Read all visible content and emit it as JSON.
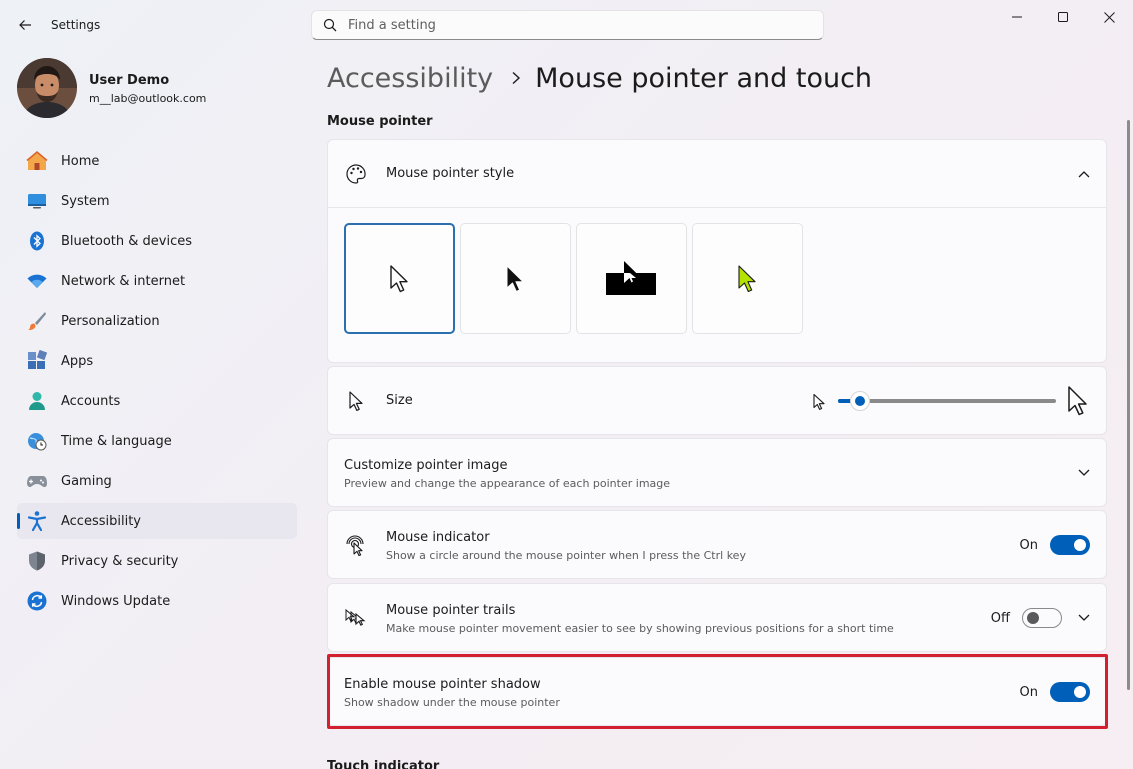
{
  "window": {
    "app_title": "Settings"
  },
  "search": {
    "placeholder": "Find a setting"
  },
  "user": {
    "name": "User Demo",
    "email": "m__lab@outlook.com"
  },
  "sidebar": {
    "items": [
      {
        "label": "Home",
        "icon": "home-icon"
      },
      {
        "label": "System",
        "icon": "system-icon"
      },
      {
        "label": "Bluetooth & devices",
        "icon": "bluetooth-icon"
      },
      {
        "label": "Network & internet",
        "icon": "wifi-icon"
      },
      {
        "label": "Personalization",
        "icon": "brush-icon"
      },
      {
        "label": "Apps",
        "icon": "apps-icon"
      },
      {
        "label": "Accounts",
        "icon": "person-icon"
      },
      {
        "label": "Time & language",
        "icon": "clock-globe-icon"
      },
      {
        "label": "Gaming",
        "icon": "gamepad-icon"
      },
      {
        "label": "Accessibility",
        "icon": "accessibility-icon",
        "active": true
      },
      {
        "label": "Privacy & security",
        "icon": "shield-icon"
      },
      {
        "label": "Windows Update",
        "icon": "update-icon"
      }
    ]
  },
  "breadcrumb": {
    "parent": "Accessibility",
    "current": "Mouse pointer and touch"
  },
  "sections": {
    "mouse_pointer": "Mouse pointer",
    "touch_indicator": "Touch indicator"
  },
  "settings": {
    "pointer_style": {
      "title": "Mouse pointer style",
      "options": [
        "white",
        "black",
        "inverted",
        "custom"
      ],
      "selected": "white",
      "custom_color": "#b4e300"
    },
    "size": {
      "title": "Size",
      "value_fraction": 0.1
    },
    "customize_image": {
      "title": "Customize pointer image",
      "description": "Preview and change the appearance of each pointer image"
    },
    "mouse_indicator": {
      "title": "Mouse indicator",
      "description": "Show a circle around the mouse pointer when I press the Ctrl key",
      "state": "On"
    },
    "pointer_trails": {
      "title": "Mouse pointer trails",
      "description": "Make mouse pointer movement easier to see by showing previous positions for a short time",
      "state": "Off"
    },
    "pointer_shadow": {
      "title": "Enable mouse pointer shadow",
      "description": "Show shadow under the mouse pointer",
      "state": "On"
    }
  },
  "colors": {
    "accent": "#005fb8",
    "highlight": "#d3202e"
  }
}
